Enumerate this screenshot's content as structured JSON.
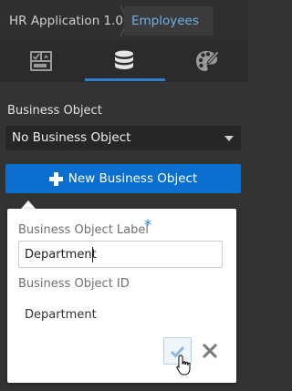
{
  "breadcrumb": {
    "app": "HR Application 1.0",
    "current": "Employees"
  },
  "tabs": [
    {
      "icon": "components-icon",
      "active": false
    },
    {
      "icon": "database-icon",
      "active": true
    },
    {
      "icon": "palette-icon",
      "active": false
    }
  ],
  "business_object": {
    "label": "Business Object",
    "selected": "No Business Object",
    "new_button_label": "New Business Object"
  },
  "popover": {
    "label_field_label": "Business Object Label",
    "required_marker": "*",
    "label_field_value": "Department",
    "id_field_label": "Business Object ID",
    "id_field_value": "Department"
  },
  "colors": {
    "accent": "#0a6fcf",
    "breadcrumb_active": "#6fb2e8",
    "tab_underline": "#2c7fd0",
    "background": "#333333"
  }
}
